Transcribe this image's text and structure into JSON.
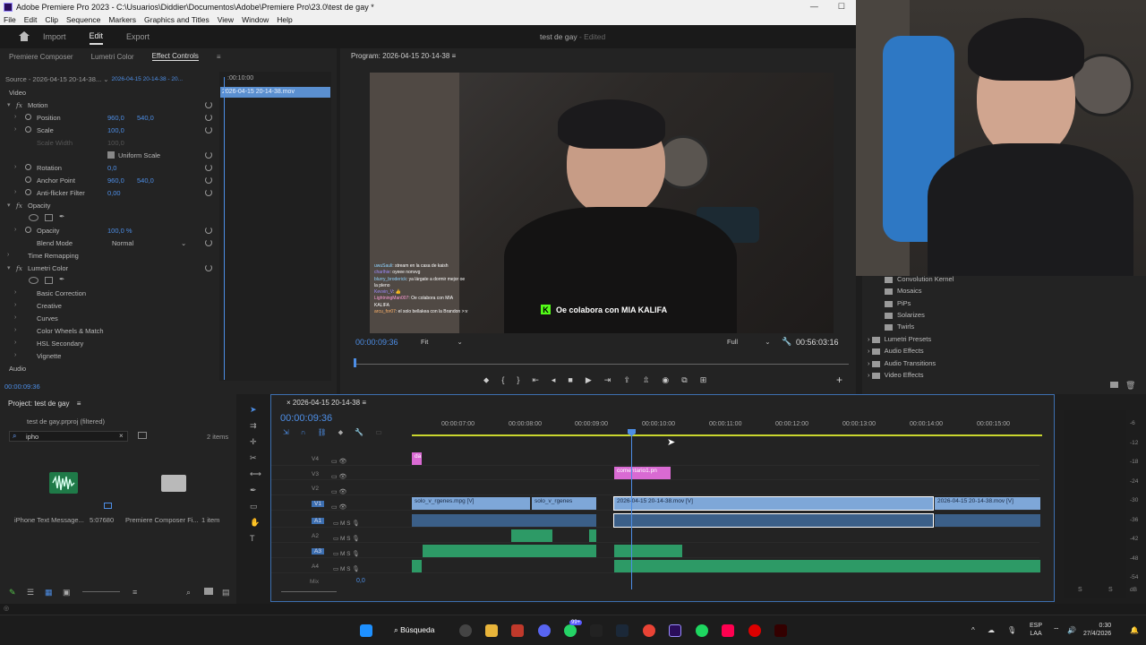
{
  "window": {
    "title": "Adobe Premiere Pro 2023 - C:\\Usuarios\\Diddier\\Documentos\\Adobe\\Premiere Pro\\23.0\\test de gay *"
  },
  "menu": [
    "File",
    "Edit",
    "Clip",
    "Sequence",
    "Markers",
    "Graphics and Titles",
    "View",
    "Window",
    "Help"
  ],
  "workspace": {
    "tabs": [
      "Import",
      "Edit",
      "Export"
    ],
    "active": "Edit",
    "doc_title": "test de gay",
    "doc_status": "- Edited"
  },
  "left_panel": {
    "tabs": [
      "Premiere Composer",
      "Lumetri Color",
      "Effect Controls"
    ],
    "source_label": "Source - 2026-04-15 20-14-38...",
    "clip_label": "2026-04-15 20-14-38 - 20...",
    "ec_time": ":00:10:00",
    "ec_clip": "2026-04-15 20-14-38.mov",
    "current_time": "00:00:09:36",
    "rows": {
      "video": "Video",
      "motion": "Motion",
      "position": "Position",
      "position_x": "960,0",
      "position_y": "540,0",
      "scale": "Scale",
      "scale_v": "100,0",
      "scale_width": "Scale Width",
      "scale_width_v": "100,0",
      "uniform_scale": "Uniform Scale",
      "rotation": "Rotation",
      "rotation_v": "0,0",
      "anchor": "Anchor Point",
      "anchor_x": "960,0",
      "anchor_y": "540,0",
      "antiflicker": "Anti-flicker Filter",
      "antiflicker_v": "0,00",
      "opacity_group": "Opacity",
      "opacity": "Opacity",
      "opacity_v": "100,0 %",
      "blend": "Blend Mode",
      "blend_v": "Normal",
      "time_remap": "Time Remapping",
      "lumetri": "Lumetri Color",
      "basic": "Basic Correction",
      "creative": "Creative",
      "curves": "Curves",
      "wheels": "Color Wheels & Match",
      "hsl": "HSL Secondary",
      "vignette": "Vignette",
      "audio": "Audio"
    }
  },
  "program": {
    "title": "Program: 2026-04-15 20-14-38",
    "timecode": "00:00:09:36",
    "fit": "Fit",
    "quality": "Full",
    "duration": "00:56:03:16",
    "caption": "Oe colabora con MIA KALIFA",
    "chat": [
      {
        "user": "uwuSauli",
        "msg": ": stream en la casa de kaish"
      },
      {
        "user": "charlhie",
        "msg": ": oyeee nonvvg"
      },
      {
        "user": "blurry_broderick",
        "msg": ": ya lárgate a dormir mejor oe"
      },
      {
        "user": "",
        "msg": "la pleno"
      },
      {
        "user": "Kevvin_V",
        "msg": ": 👍"
      },
      {
        "user": "LightningMan007",
        "msg": ": Oe colabora con MIA"
      },
      {
        "user": "",
        "msg": "KALIFA"
      },
      {
        "user": "arcu_for07",
        "msg": ": el solo bellakea con la Brandon >:v"
      }
    ]
  },
  "effects_list": [
    "Convolution Kernel",
    "Mosaics",
    "PiPs",
    "Solarizes",
    "Twirls",
    "Lumetri Presets",
    "Audio Effects",
    "Audio Transitions",
    "Video Effects"
  ],
  "project": {
    "title": "Project: test de gay",
    "file": "test de gay.prproj (filtered)",
    "search": "ipho",
    "count": "2 items",
    "items": [
      {
        "name": "iPhone Text Message...",
        "duration": "5:07680"
      },
      {
        "name": "Premiere Composer Fi...",
        "duration": "1 item"
      }
    ]
  },
  "timeline": {
    "sequence": "2026-04-15 20-14-38",
    "timecode": "00:00:09:36",
    "ticks": [
      "00:00:07:00",
      "00:00:08:00",
      "00:00:09:00",
      "00:00:10:00",
      "00:00:11:00",
      "00:00:12:00",
      "00:00:13:00",
      "00:00:14:00",
      "00:00:15:00"
    ],
    "tracks": [
      "V4",
      "V3",
      "V2",
      "V1",
      "A1",
      "A2",
      "A3",
      "A4"
    ],
    "mix_label": "Mix",
    "mix_value": "0,0",
    "clips": {
      "v4": "da",
      "v3": "comentario1.pn",
      "v1a": "solo_v_rgenes.mpg [V]",
      "v1b": "solo_v_rgenes",
      "v1c": "2026-04-15 20-14-38.mov [V]",
      "v1d": "2026-04-15 20-14-38.mov [V]"
    },
    "meter_db": [
      "-6",
      "-12",
      "-18",
      "-24",
      "-30",
      "-36",
      "-42",
      "-48",
      "-54",
      "dB"
    ]
  },
  "taskbar": {
    "search": "Búsqueda",
    "lang1": "ESP",
    "lang2": "LAA",
    "time": "0:30",
    "date": "27/4/2026",
    "badge": "99+"
  },
  "colors": {
    "accent": "#4d8ee6",
    "video_clip": "#7ea7d8",
    "graphic_clip": "#d96ad3",
    "audio_clip": "#2d9a66",
    "ruler": "#c9d62e"
  }
}
